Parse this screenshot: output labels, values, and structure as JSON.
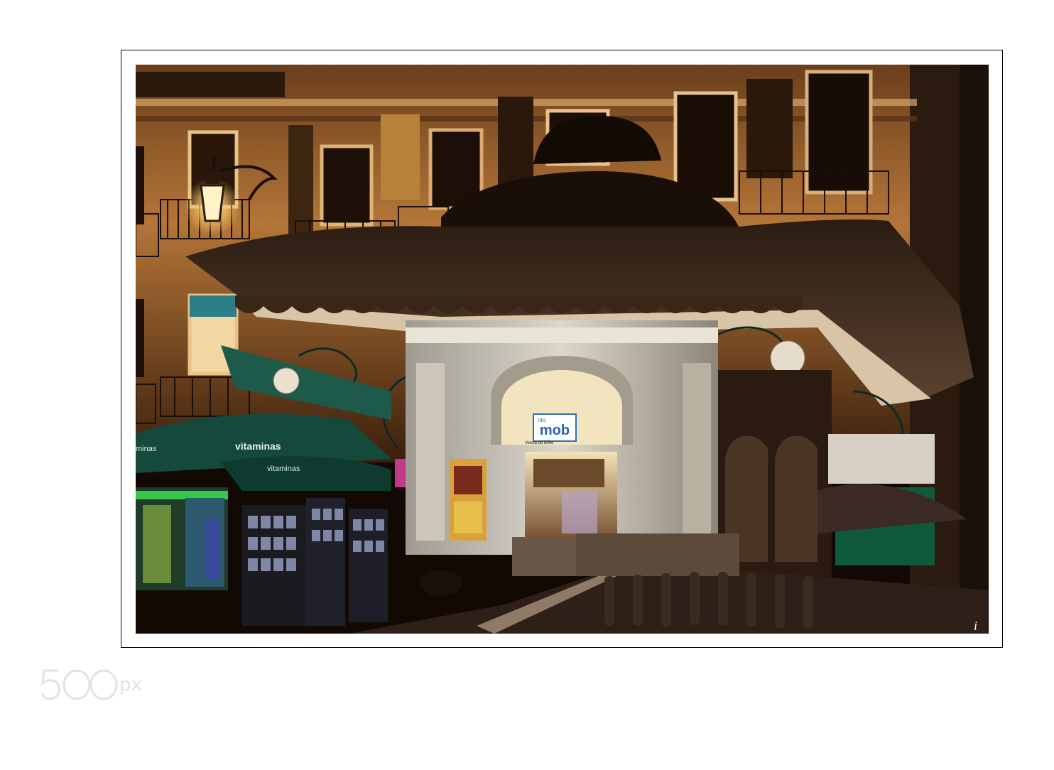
{
  "photo": {
    "signs": {
      "umbrella_brand": "vitaminas",
      "umbrella_brand_lower": "vitaminas",
      "side_brand": "minas",
      "kiosk_sign_main": "mob",
      "kiosk_sign_prefix": "nto",
      "kiosk_sign_small": "Venda de Bilhe"
    },
    "signature_mark": "i"
  },
  "watermark": {
    "text": "500px"
  },
  "colors": {
    "frame_border": "#000000",
    "watermark": "#e2e2e2",
    "night_sky": "#0d0805",
    "facade_light": "#c98a48",
    "umbrella_green": "#14493c"
  }
}
